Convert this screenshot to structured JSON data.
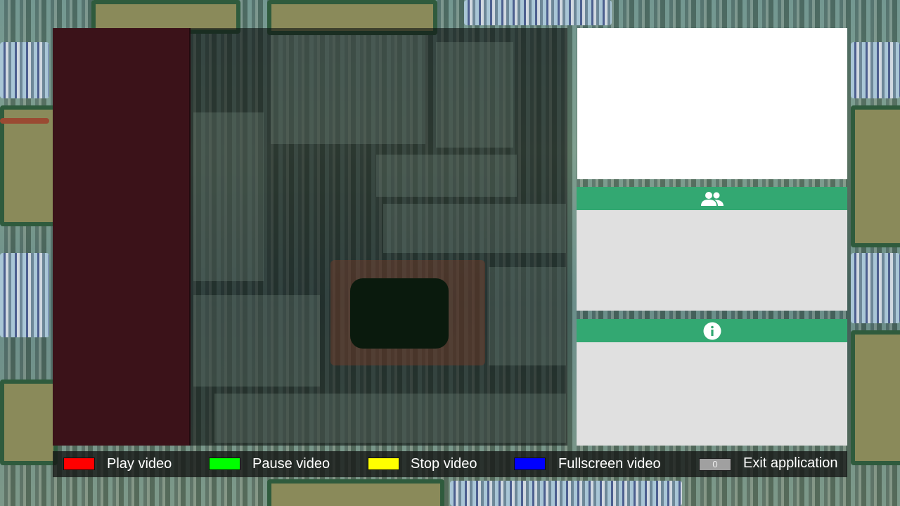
{
  "controls": [
    {
      "color": "#ff0000",
      "label": "Play video"
    },
    {
      "color": "#00ff00",
      "label": "Pause video"
    },
    {
      "color": "#ffff00",
      "label": "Stop video"
    },
    {
      "color": "#0000ff",
      "label": "Fullscreen video"
    }
  ],
  "exit": {
    "key": "0",
    "label": "Exit application"
  },
  "panels": {
    "users_icon": "people-icon",
    "info_icon": "info-icon",
    "header_color": "#33a872"
  }
}
